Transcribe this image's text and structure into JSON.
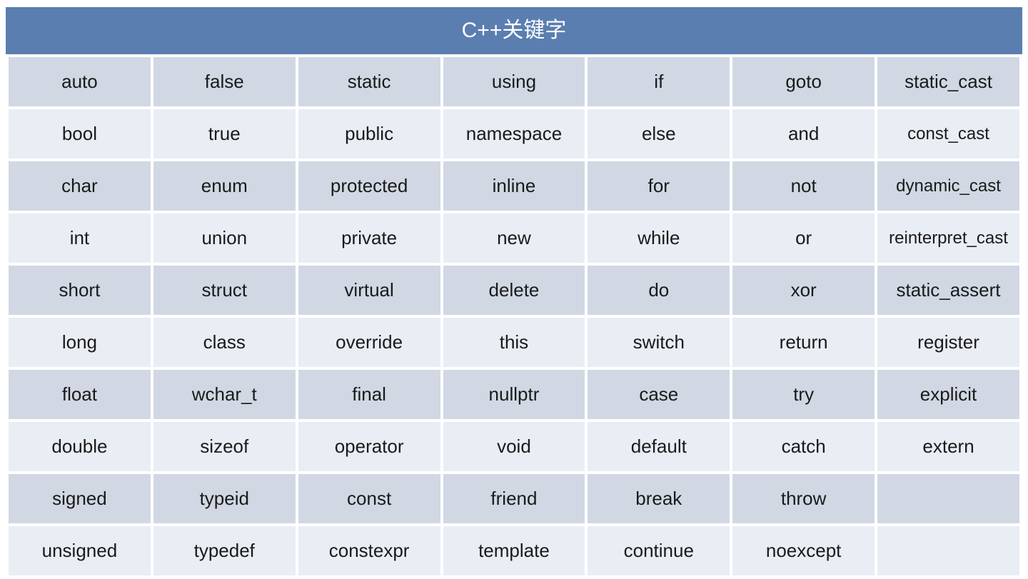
{
  "title": "C++关键字",
  "colors": {
    "header_bg": "#5b7eb0",
    "header_fg": "#ffffff",
    "row_odd_bg": "#d1d8e4",
    "row_even_bg": "#e9edf4",
    "cell_fg": "#1a1a1a"
  },
  "columns": 7,
  "rows": [
    [
      "auto",
      "false",
      "static",
      "using",
      "if",
      "goto",
      "static_cast"
    ],
    [
      "bool",
      "true",
      "public",
      "namespace",
      "else",
      "and",
      "const_cast"
    ],
    [
      "char",
      "enum",
      "protected",
      "inline",
      "for",
      "not",
      "dynamic_cast"
    ],
    [
      "int",
      "union",
      "private",
      "new",
      "while",
      "or",
      "reinterpret_cast"
    ],
    [
      "short",
      "struct",
      "virtual",
      "delete",
      "do",
      "xor",
      "static_assert"
    ],
    [
      "long",
      "class",
      "override",
      "this",
      "switch",
      "return",
      "register"
    ],
    [
      "float",
      "wchar_t",
      "final",
      "nullptr",
      "case",
      "try",
      "explicit"
    ],
    [
      "double",
      "sizeof",
      "operator",
      "void",
      "default",
      "catch",
      "extern"
    ],
    [
      "signed",
      "typeid",
      "const",
      "friend",
      "break",
      "throw",
      ""
    ],
    [
      "unsigned",
      "typedef",
      "constexpr",
      "template",
      "continue",
      "noexcept",
      ""
    ]
  ]
}
